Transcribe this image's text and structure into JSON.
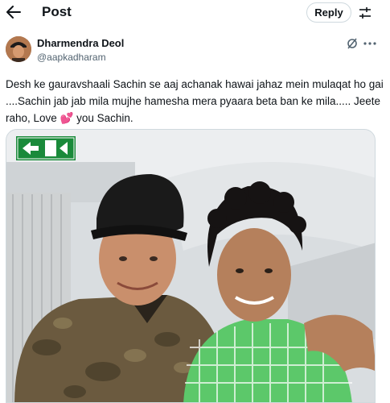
{
  "header": {
    "title": "Post",
    "reply_label": "Reply"
  },
  "post": {
    "author_name": "Dharmendra Deol",
    "author_handle": "@aapkadharam",
    "text_before_emoji": "Desh ke gauravshaali Sachin se aaj  achanak hawai jahaz mein mulaqat ho gai ....Sachin jab jab mila mujhe hamesha mera pyaara beta ban ke mila..... Jeete raho, Love ",
    "emoji": "💕",
    "text_after_emoji": " you Sachin."
  },
  "media": {
    "exit_sign_icon": "exit-arrow-running-person"
  },
  "colors": {
    "text_primary": "#0f1419",
    "text_secondary": "#536471",
    "border": "#cfd9de",
    "heart": "#e0245e",
    "exit_sign": "#1a8a3a"
  }
}
